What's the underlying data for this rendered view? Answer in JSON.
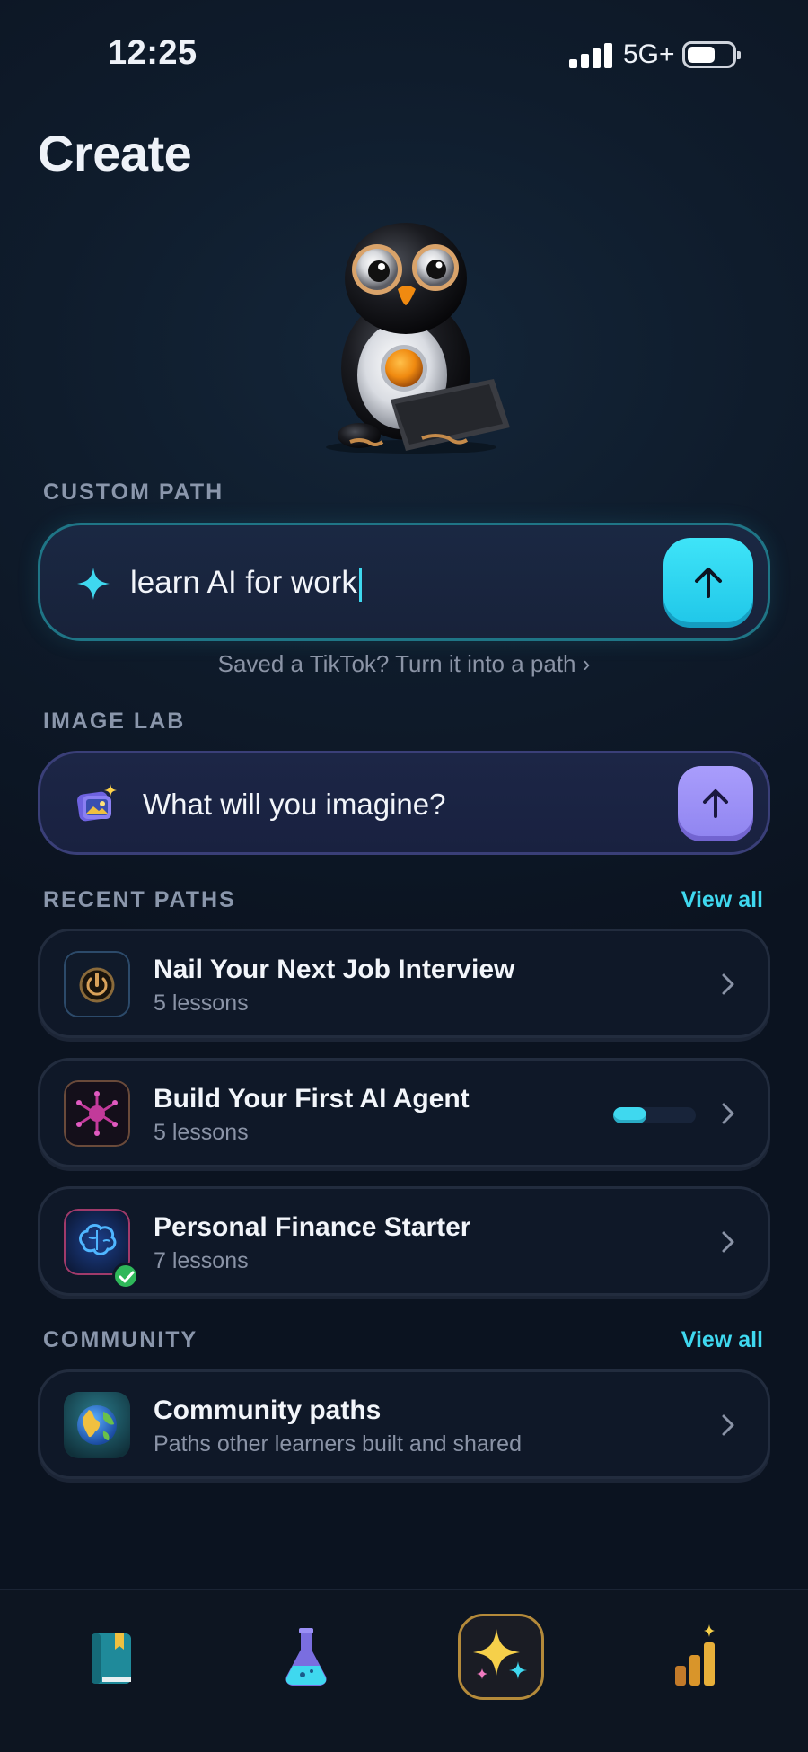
{
  "status_bar": {
    "time": "12:25",
    "network": "5G+"
  },
  "page_title": "Create",
  "custom_path": {
    "section_label": "CUSTOM PATH",
    "input_value": "learn AI for work",
    "tiktok_link": "Saved a TikTok? Turn it into a path ›"
  },
  "image_lab": {
    "section_label": "IMAGE LAB",
    "placeholder": "What will you imagine?"
  },
  "recent_paths": {
    "section_label": "RECENT PATHS",
    "view_all": "View all",
    "items": [
      {
        "title": "Nail Your Next Job Interview",
        "subtitle": "5 lessons",
        "icon": "power-icon"
      },
      {
        "title": "Build Your First AI Agent",
        "subtitle": "5 lessons",
        "icon": "agent-icon",
        "progress": 0.4
      },
      {
        "title": "Personal Finance Starter",
        "subtitle": "7 lessons",
        "icon": "brain-icon",
        "completed": true
      }
    ]
  },
  "community": {
    "section_label": "COMMUNITY",
    "view_all": "View all",
    "item": {
      "title": "Community paths",
      "subtitle": "Paths other learners built and shared",
      "icon": "globe-icon"
    }
  },
  "bottom_nav": [
    {
      "icon": "book-icon"
    },
    {
      "icon": "flask-icon"
    },
    {
      "icon": "sparkles-icon",
      "active": true
    },
    {
      "icon": "bar-chart-icon"
    }
  ],
  "colors": {
    "accent_cyan": "#3fd8ef",
    "accent_purple": "#9a8ff6",
    "background": "#0c1422"
  }
}
